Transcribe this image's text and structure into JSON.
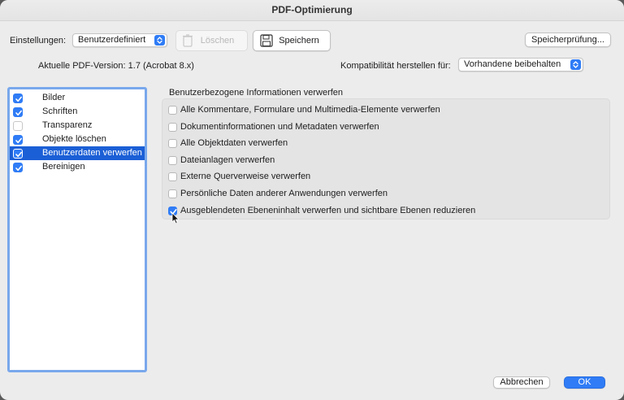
{
  "window": {
    "title": "PDF-Optimierung"
  },
  "toolbar": {
    "settings_label": "Einstellungen:",
    "settings_value": "Benutzerdefiniert",
    "delete_label": "Löschen",
    "save_label": "Speichern",
    "check_label": "Speicherprüfung..."
  },
  "version": {
    "current_label": "Aktuelle PDF-Version: 1.7 (Acrobat 8.x)",
    "compat_label": "Kompatibilität herstellen für:",
    "compat_value": "Vorhandene beibehalten"
  },
  "sidebar": {
    "items": [
      {
        "label": "Bilder",
        "checked": true
      },
      {
        "label": "Schriften",
        "checked": true
      },
      {
        "label": "Transparenz",
        "checked": false
      },
      {
        "label": "Objekte löschen",
        "checked": true
      },
      {
        "label": "Benutzerdaten verwerfen",
        "checked": true,
        "selected": true
      },
      {
        "label": "Bereinigen",
        "checked": true
      }
    ]
  },
  "panel": {
    "heading": "Benutzerbezogene Informationen verwerfen",
    "options": [
      {
        "label": "Alle Kommentare, Formulare und Multimedia-Elemente verwerfen",
        "checked": false
      },
      {
        "label": "Dokumentinformationen und Metadaten verwerfen",
        "checked": false
      },
      {
        "label": "Alle Objektdaten verwerfen",
        "checked": false
      },
      {
        "label": "Dateianlagen verwerfen",
        "checked": false
      },
      {
        "label": "Externe Querverweise verwerfen",
        "checked": false
      },
      {
        "label": "Persönliche Daten anderer Anwendungen verwerfen",
        "checked": false
      },
      {
        "label": "Ausgeblendeten Ebeneninhalt verwerfen und sichtbare Ebenen reduzieren",
        "checked": true
      }
    ]
  },
  "footer": {
    "cancel_label": "Abbrechen",
    "ok_label": "OK"
  },
  "colors": {
    "accent": "#2f7cf6",
    "selection": "#1b5fd6",
    "focus_ring": "#79a8ec"
  }
}
